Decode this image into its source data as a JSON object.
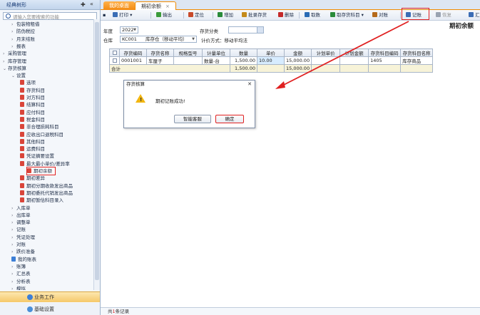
{
  "sidebar": {
    "title": "经典树形",
    "search_placeholder": "请输入您要搜索的功能",
    "tree": [
      {
        "label": "包装物租借",
        "level": 2,
        "icon": "arrow"
      },
      {
        "label": "防伪税控",
        "level": 2,
        "icon": "arrow"
      },
      {
        "label": "月末结账",
        "level": 2,
        "icon": "arrow"
      },
      {
        "label": "报表",
        "level": 2,
        "icon": "arrow"
      },
      {
        "label": "采购管理",
        "level": 1,
        "icon": "arrow"
      },
      {
        "label": "库存管理",
        "level": 1,
        "icon": "arrow"
      },
      {
        "label": "存货核算",
        "level": 1,
        "icon": "arrow-open"
      },
      {
        "label": "设置",
        "level": 2,
        "icon": "arrow-open"
      },
      {
        "label": "选项",
        "level": 3,
        "icon": "doc"
      },
      {
        "label": "存货科目",
        "level": 3,
        "icon": "doc"
      },
      {
        "label": "对方科目",
        "level": 3,
        "icon": "doc"
      },
      {
        "label": "结算科目",
        "level": 3,
        "icon": "doc"
      },
      {
        "label": "应付科目",
        "level": 3,
        "icon": "doc"
      },
      {
        "label": "税金科目",
        "level": 3,
        "icon": "doc"
      },
      {
        "label": "非合理损耗科目",
        "level": 3,
        "icon": "doc"
      },
      {
        "label": "应收出口退税科目",
        "level": 3,
        "icon": "doc"
      },
      {
        "label": "其他科目",
        "level": 3,
        "icon": "doc"
      },
      {
        "label": "运费科目",
        "level": 3,
        "icon": "doc"
      },
      {
        "label": "凭证摘要设置",
        "level": 3,
        "icon": "doc"
      },
      {
        "label": "最大最小单价/差异率",
        "level": 3,
        "icon": "doc"
      },
      {
        "label": "期初余额",
        "level": 3,
        "icon": "doc",
        "selected": true
      },
      {
        "label": "期初差异",
        "level": 3,
        "icon": "doc"
      },
      {
        "label": "期初分期收款发出商品",
        "level": 3,
        "icon": "doc"
      },
      {
        "label": "期初委托代销发出商品",
        "level": 3,
        "icon": "doc"
      },
      {
        "label": "期初暂估科目录入",
        "level": 3,
        "icon": "doc"
      },
      {
        "label": "入库单",
        "level": 2,
        "icon": "arrow"
      },
      {
        "label": "出库单",
        "level": 2,
        "icon": "arrow"
      },
      {
        "label": "调整单",
        "level": 2,
        "icon": "arrow"
      },
      {
        "label": "记账",
        "level": 2,
        "icon": "arrow"
      },
      {
        "label": "凭证处理",
        "level": 2,
        "icon": "arrow"
      },
      {
        "label": "对账",
        "level": 2,
        "icon": "arrow"
      },
      {
        "label": "跌价准备",
        "level": 2,
        "icon": "arrow"
      },
      {
        "label": "我的账表",
        "level": 2,
        "icon": "docblue"
      },
      {
        "label": "账簿",
        "level": 2,
        "icon": "arrow"
      },
      {
        "label": "汇总表",
        "level": 2,
        "icon": "arrow"
      },
      {
        "label": "分析表",
        "level": 2,
        "icon": "arrow"
      },
      {
        "label": "模拟",
        "level": 2,
        "icon": "arrow"
      }
    ],
    "bottom_nav": [
      "业务工作",
      "基础设置"
    ]
  },
  "tabs": [
    {
      "label": "我的桌面",
      "active": false
    },
    {
      "label": "期初余额",
      "active": true
    }
  ],
  "toolbar": {
    "items": [
      {
        "label": "打印",
        "icon": "print-icon",
        "dropdown": true
      },
      {
        "label": "输出",
        "icon": "export-icon"
      },
      {
        "label": "定位",
        "icon": "locate-icon"
      },
      {
        "label": "增加",
        "icon": "add-icon"
      },
      {
        "label": "批录存货",
        "icon": "batch-icon"
      },
      {
        "label": "删除",
        "icon": "delete-icon"
      },
      {
        "label": "取数",
        "icon": "fetch-icon"
      },
      {
        "label": "取存货科目",
        "icon": "fetch-account-icon",
        "dropdown": true
      },
      {
        "label": "对账",
        "icon": "reconcile-icon"
      },
      {
        "label": "记账",
        "icon": "post-icon"
      },
      {
        "label": "恢复",
        "icon": "restore-icon",
        "disabled": true
      },
      {
        "label": "汇",
        "icon": "summary-icon"
      }
    ],
    "icon_colors": [
      "#3b6db5",
      "#3b9b3b",
      "#c84a2a",
      "#2a8b3a",
      "#c48a1a",
      "#c42a2a",
      "#2a6bb5",
      "#2a8b3a",
      "#b56a1a",
      "#3b6db5",
      "#9aa4b2",
      "#3b6db5"
    ]
  },
  "form": {
    "title": "期初余额",
    "year_label": "年度",
    "year_value": "2022",
    "warehouse_label": "仓库",
    "warehouse_code": "KC001",
    "warehouse_name": "库存仓（移动平均）",
    "category_label": "存货分类",
    "category_value": "",
    "valuation": "计价方式：移动平均法"
  },
  "grid": {
    "columns": [
      "存货编码",
      "存货名称",
      "规格型号",
      "计量单位",
      "数量",
      "单价",
      "金额",
      "计划单价",
      "计划金额",
      "存货科目编码",
      "存货科目名称"
    ],
    "rows": [
      {
        "code": "0001001",
        "name": "车厘子",
        "spec": "",
        "unit": "数量-台",
        "qty": "1,500.00",
        "price": "10.00",
        "amount": "15,000.00",
        "plan_price": "",
        "plan_amount": "",
        "acct_code": "1405",
        "acct_name": "库存商品"
      }
    ],
    "total": {
      "label": "合计",
      "qty": "1,500.00",
      "amount": "15,000.00"
    }
  },
  "dialog": {
    "title": "存货核算",
    "message": "期初记账成功!",
    "buttons": [
      "智能客服",
      "确定"
    ]
  },
  "footer": {
    "prefix": "共",
    "count": "1",
    "suffix": "条记录"
  },
  "colors": {
    "accent": "#f08a00",
    "highlight": "#e02020",
    "selection": "#d7ecff"
  }
}
